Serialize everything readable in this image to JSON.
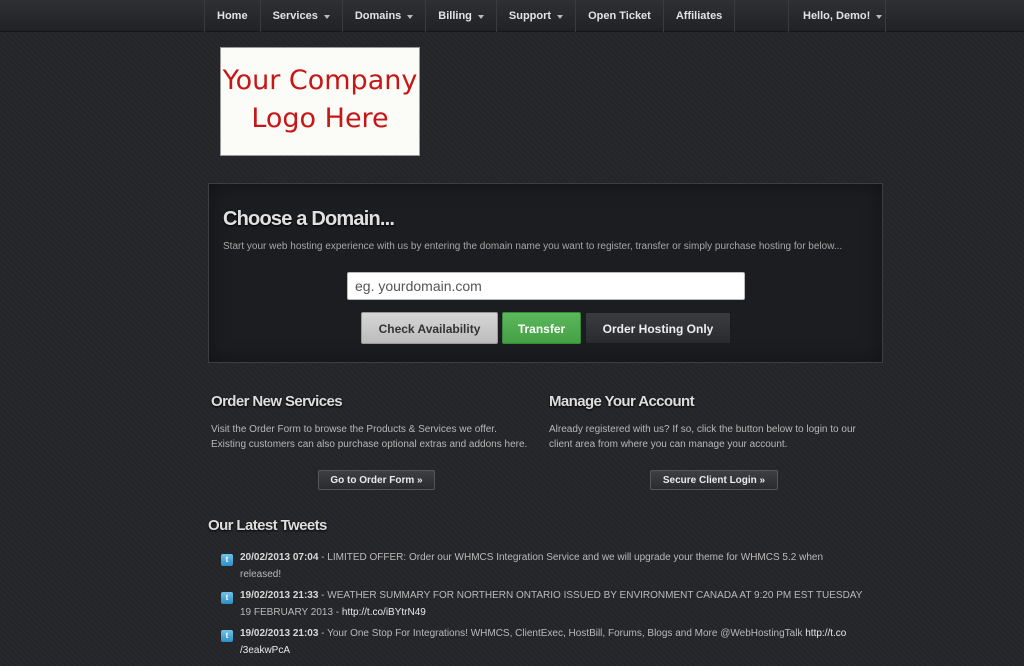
{
  "nav": {
    "items": [
      {
        "label": "Home",
        "dropdown": false
      },
      {
        "label": "Services",
        "dropdown": true
      },
      {
        "label": "Domains",
        "dropdown": true
      },
      {
        "label": "Billing",
        "dropdown": true
      },
      {
        "label": "Support",
        "dropdown": true
      },
      {
        "label": "Open Ticket",
        "dropdown": false
      },
      {
        "label": "Affiliates",
        "dropdown": false
      }
    ],
    "user": "Hello, Demo!"
  },
  "logo": {
    "line1": "Your Company",
    "line2": "Logo Here"
  },
  "domain": {
    "title": "Choose a Domain...",
    "description": "Start your web hosting experience with us by entering the domain name you want to register, transfer or simply purchase hosting for below...",
    "placeholder": "eg. yourdomain.com",
    "buttons": {
      "check": "Check Availability",
      "transfer": "Transfer",
      "hosting": "Order Hosting Only"
    }
  },
  "order": {
    "title": "Order New Services",
    "text_line1": "Visit the Order Form to browse the Products & Services we offer.",
    "text_line2": "Existing customers can also purchase optional extras and addons here.",
    "button": "Go to Order Form »"
  },
  "account": {
    "title": "Manage Your Account",
    "text_line1": "Already registered with us? If so, click the button below to login to our",
    "text_line2": "client area from where you can manage your account.",
    "button": "Secure Client Login »"
  },
  "tweets": {
    "title": "Our Latest Tweets",
    "items": [
      {
        "date": "20/02/2013 07:04",
        "text_line1": " - LIMITED OFFER: Order our WHMCS Integration Service and we will upgrade your theme for WHMCS 5.2 when",
        "text_line2": "released!",
        "link": ""
      },
      {
        "date": "19/02/2013 21:33",
        "text_line1": " - WEATHER SUMMARY FOR NORTHERN ONTARIO ISSUED BY ENVIRONMENT CANADA AT 9:20 PM EST TUESDAY",
        "text_line2": "19 FEBRUARY 2013 - ",
        "link": "http://t.co/iBYtrN49"
      },
      {
        "date": "19/02/2013 21:03",
        "text_line1": " - Your One Stop For Integrations! WHMCS, ClientExec, HostBill, Forums, Blogs and More @WebHostingTalk ",
        "link_line1": "http://t.co",
        "text_line2": "",
        "link": "/3eakwPcA"
      }
    ]
  },
  "colors": {
    "background": "#25262a",
    "accent_green": "#5cb85c",
    "logo_red": "#c71616"
  }
}
